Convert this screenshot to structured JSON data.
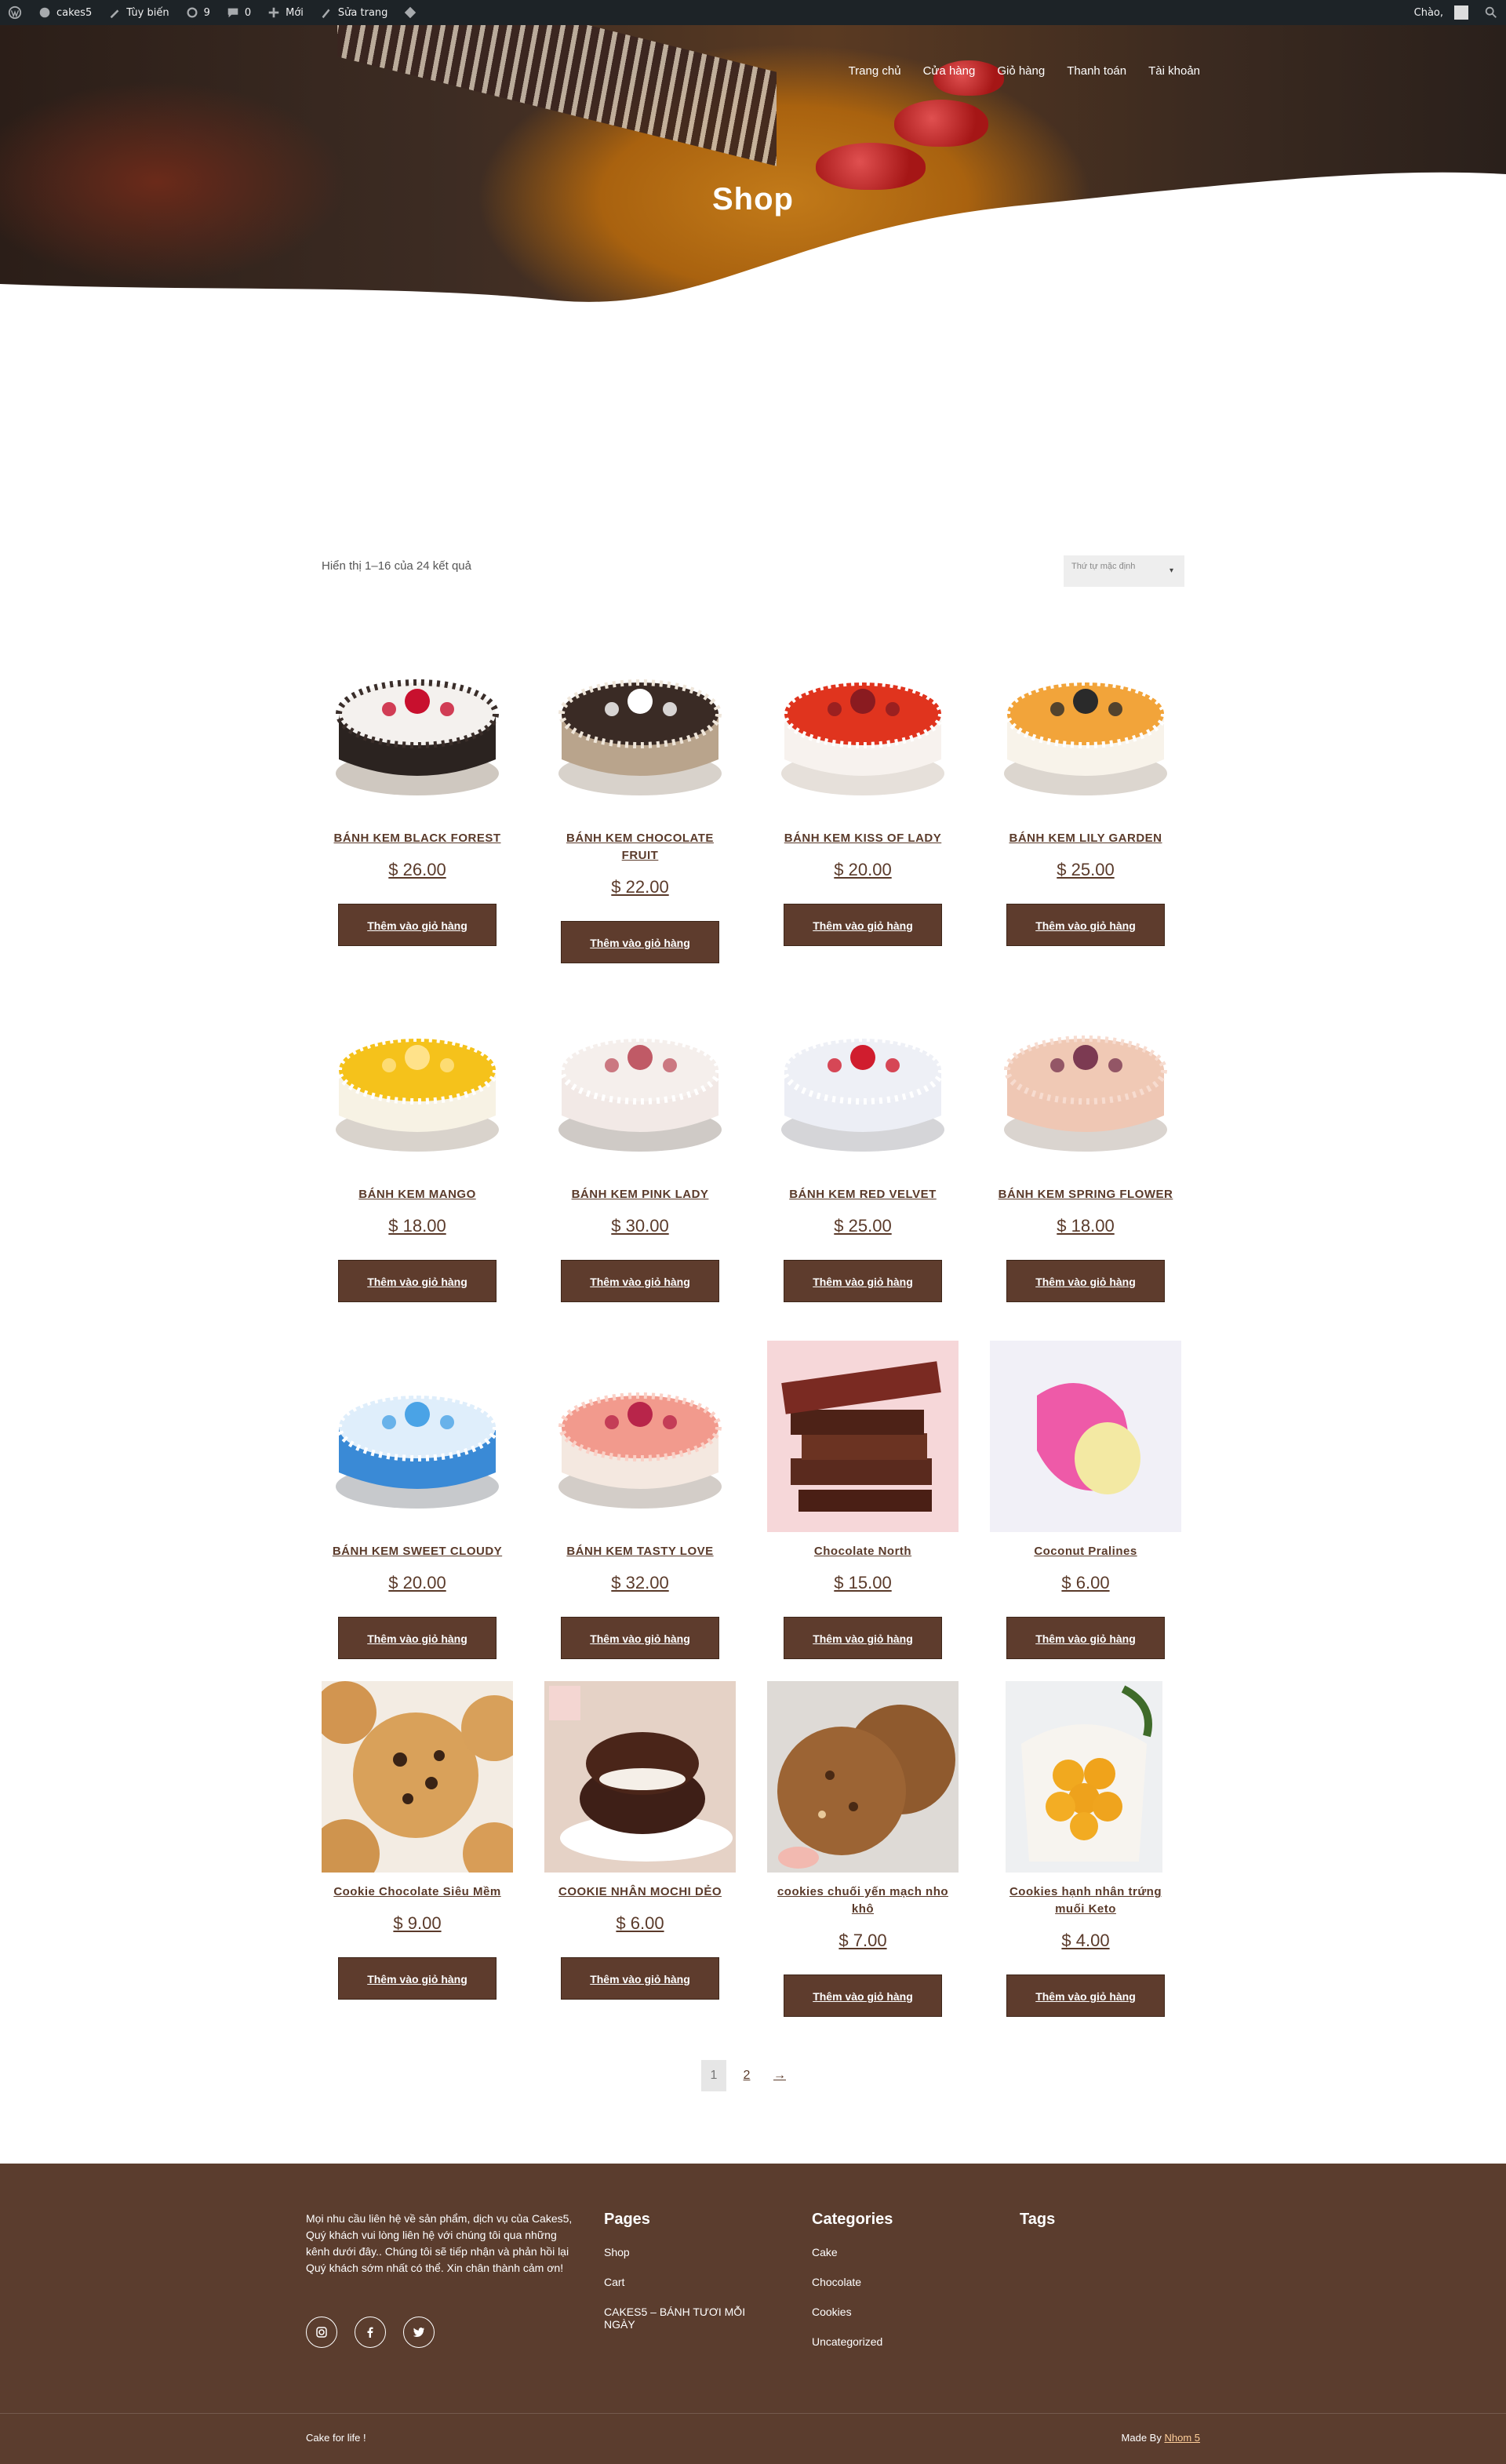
{
  "admin_bar": {
    "site_name": "cakes5",
    "customize": "Tùy biến",
    "updates": "9",
    "comments": "0",
    "new": "Mới",
    "edit_page": "Sửa trang",
    "greeting": "Chào,"
  },
  "header": {
    "nav": [
      "Trang chủ",
      "Cửa hàng",
      "Giỏ hàng",
      "Thanh toán",
      "Tài khoản"
    ],
    "title": "Shop"
  },
  "shop": {
    "result_count": "Hiển thị 1–16 của 24 kết quả",
    "orderby": "Thứ tự mặc định",
    "add_to_cart": "Thêm vào giỏ hàng",
    "products": [
      {
        "name": "BÁNH KEM BLACK FOREST",
        "price": "$ 26.00",
        "image": "black-forest-cake"
      },
      {
        "name": "BÁNH KEM CHOCOLATE FRUIT",
        "price": "$ 22.00",
        "image": "chocolate-fruit-cake"
      },
      {
        "name": "BÁNH KEM KISS OF LADY",
        "price": "$ 20.00",
        "image": "kiss-of-lady-cake"
      },
      {
        "name": "BÁNH KEM LILY GARDEN",
        "price": "$ 25.00",
        "image": "lily-garden-cake"
      },
      {
        "name": "BÁNH KEM MANGO",
        "price": "$ 18.00",
        "image": "mango-cake"
      },
      {
        "name": "BÁNH KEM PINK LADY",
        "price": "$ 30.00",
        "image": "pink-lady-cake"
      },
      {
        "name": "BÁNH KEM RED VELVET",
        "price": "$ 25.00",
        "image": "red-velvet-cake"
      },
      {
        "name": "BÁNH KEM SPRING FLOWER",
        "price": "$ 18.00",
        "image": "spring-flower-cake"
      },
      {
        "name": "BÁNH KEM SWEET CLOUDY",
        "price": "$ 20.00",
        "image": "sweet-cloudy-cake"
      },
      {
        "name": "BÁNH KEM TASTY LOVE",
        "price": "$ 32.00",
        "image": "tasty-love-cake"
      },
      {
        "name": "Chocolate North",
        "price": "$ 15.00",
        "image": "chocolate-bars"
      },
      {
        "name": "Coconut Pralines",
        "price": "$ 6.00",
        "image": "coconut-pralines"
      },
      {
        "name": "Cookie Chocolate Siêu Mềm",
        "price": "$ 9.00",
        "image": "chocolate-chip-cookies"
      },
      {
        "name": "COOKIE NHÂN MOCHI DẺO",
        "price": "$ 6.00",
        "image": "mochi-cookie"
      },
      {
        "name": "cookies chuối yến mạch nho khô",
        "price": "$ 7.00",
        "image": "oat-banana-cookies"
      },
      {
        "name": "Cookies hạnh nhân trứng muối Keto",
        "price": "$ 4.00",
        "image": "almond-egg-cookies"
      }
    ]
  },
  "pagination": {
    "current": "1",
    "next_page": "2",
    "next_arrow": "→"
  },
  "footer": {
    "about": "Mọi nhu cầu liên hệ về sản phẩm, dịch vụ của Cakes5, Quý khách vui lòng liên hệ với chúng tôi qua những kênh dưới đây.. Chúng tôi sẽ tiếp nhận và phản hồi lại Quý khách sớm nhất có thể. Xin chân thành cảm ơn!",
    "pages_title": "Pages",
    "pages": [
      "Shop",
      "Cart",
      "CAKES5 – BÁNH TƯƠI MỖI NGÀY"
    ],
    "categories_title": "Categories",
    "categories": [
      "Cake",
      "Chocolate",
      "Cookies",
      "Uncategorized"
    ],
    "tags_title": "Tags",
    "copyright": "Cake for life !",
    "made_by_prefix": "Made By",
    "made_by_link": "Nhom 5"
  },
  "colors": {
    "brand_brown": "#5e3c2d",
    "footer_bg": "#5b3d2e",
    "admin_bar": "#1d2327"
  }
}
